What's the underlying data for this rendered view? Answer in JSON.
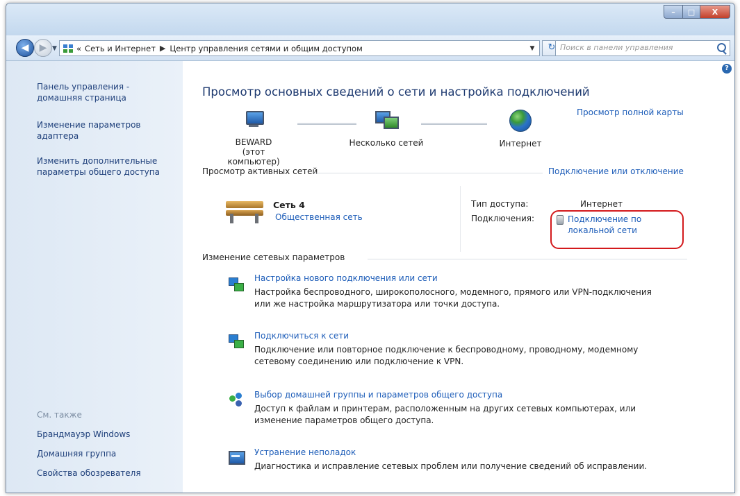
{
  "window": {
    "caption_buttons": {
      "minimize": "–",
      "maximize": "□",
      "close": "X"
    }
  },
  "nav": {
    "back_glyph": "◀",
    "forward_glyph": "▶",
    "crumb_prefix": "«",
    "crumbs": [
      "Сеть и Интернет",
      "Центр управления сетями и общим доступом"
    ],
    "search_placeholder": "Поиск в панели управления",
    "icons": [
      "back-arrow-icon",
      "forward-arrow-icon",
      "network-folder-icon",
      "refresh-icon",
      "search-icon"
    ]
  },
  "sidebar": {
    "home_link": "Панель управления - домашняя страница",
    "links": [
      "Изменение параметров адаптера",
      "Изменить дополнительные параметры общего доступа"
    ],
    "see_also_label": "См. также",
    "see_also_links": [
      "Брандмауэр Windows",
      "Домашняя группа",
      "Свойства обозревателя"
    ]
  },
  "main": {
    "help_glyph": "?",
    "title": "Просмотр основных сведений о сети и настройка подключений",
    "full_map_link": "Просмотр полной карты",
    "map": {
      "computer_name": "BEWARD",
      "computer_sub": "(этот компьютер)",
      "networks_label": "Несколько сетей",
      "internet_label": "Интернет"
    },
    "active_networks": {
      "header": "Просмотр активных сетей",
      "connect_link": "Подключение или отключение",
      "network_name": "Сеть 4",
      "network_type": "Общественная сеть",
      "access_type_label": "Тип доступа:",
      "access_type_value": "Интернет",
      "connections_label": "Подключения:",
      "connection_line1": "Подключение по",
      "connection_line2": "локальной сети"
    },
    "change_settings": {
      "header": "Изменение сетевых параметров",
      "tasks": [
        {
          "title": "Настройка нового подключения или сети",
          "desc1": "Настройка беспроводного, широкополосного, модемного, прямого или VPN-подключения",
          "desc2": "или же настройка маршрутизатора или точки доступа."
        },
        {
          "title": "Подключиться к сети",
          "desc1": "Подключение или повторное подключение к беспроводному, проводному, модемному",
          "desc2": "сетевому соединению или подключение к VPN."
        },
        {
          "title": "Выбор домашней группы и параметров общего доступа",
          "desc1": "Доступ к файлам и принтерам, расположенным на других сетевых компьютерах, или",
          "desc2": "изменение параметров общего доступа."
        },
        {
          "title": "Устранение неполадок",
          "desc1": "Диагностика и исправление сетевых проблем или получение сведений об исправлении.",
          "desc2": ""
        }
      ]
    },
    "highlight_color": "#d3191c"
  }
}
